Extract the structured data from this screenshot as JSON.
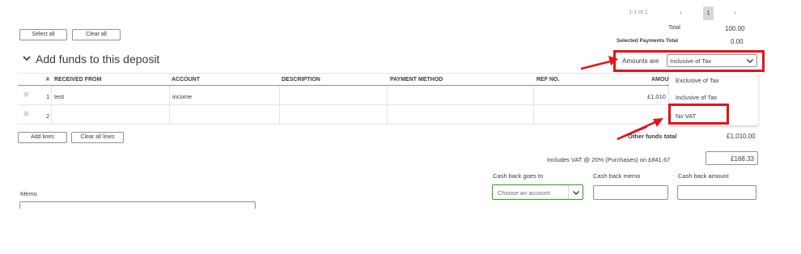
{
  "pagination": {
    "range": "1-1 of 1",
    "prev_icon": "chevron-left",
    "page": "1",
    "next_icon": "chevron-right"
  },
  "totals": {
    "total_label": "Total",
    "total_value": "100.00",
    "selected_label": "Selected Payments Total",
    "selected_value": "0.00"
  },
  "buttons": {
    "select_all": "Select all",
    "clear_all": "Clear all",
    "add_lines": "Add lines",
    "clear_all_lines": "Clear all lines"
  },
  "section": {
    "title": "Add funds to this deposit"
  },
  "amounts": {
    "label": "Amounts are",
    "selected": "Inclusive of Tax",
    "options": [
      "Exclusive of Tax",
      "Inclusive of Tax",
      "No VAT"
    ]
  },
  "table": {
    "columns": [
      "#",
      "RECEIVED FROM",
      "ACCOUNT",
      "DESCRIPTION",
      "PAYMENT METHOD",
      "REF NO.",
      "AMOU"
    ],
    "rows": [
      {
        "num": "1",
        "received_from": "test",
        "account": "income",
        "amount": "£1,010"
      },
      {
        "num": "2",
        "received_from": "",
        "account": "",
        "amount": ""
      }
    ]
  },
  "other_funds": {
    "label": "Other funds total",
    "value": "£1,010.00"
  },
  "vat": {
    "text": "Includes VAT @ 20% (Purchases) on £841.67",
    "value": "£168.33"
  },
  "cashback": {
    "goes_to_label": "Cash back goes to",
    "goes_to_placeholder": "Choose an account",
    "memo_label": "Cash back memo",
    "amount_label": "Cash back amount"
  },
  "memo": {
    "label": "Memo"
  },
  "colors": {
    "annotation_red": "#e1141b",
    "select_green": "#2ca01c"
  }
}
